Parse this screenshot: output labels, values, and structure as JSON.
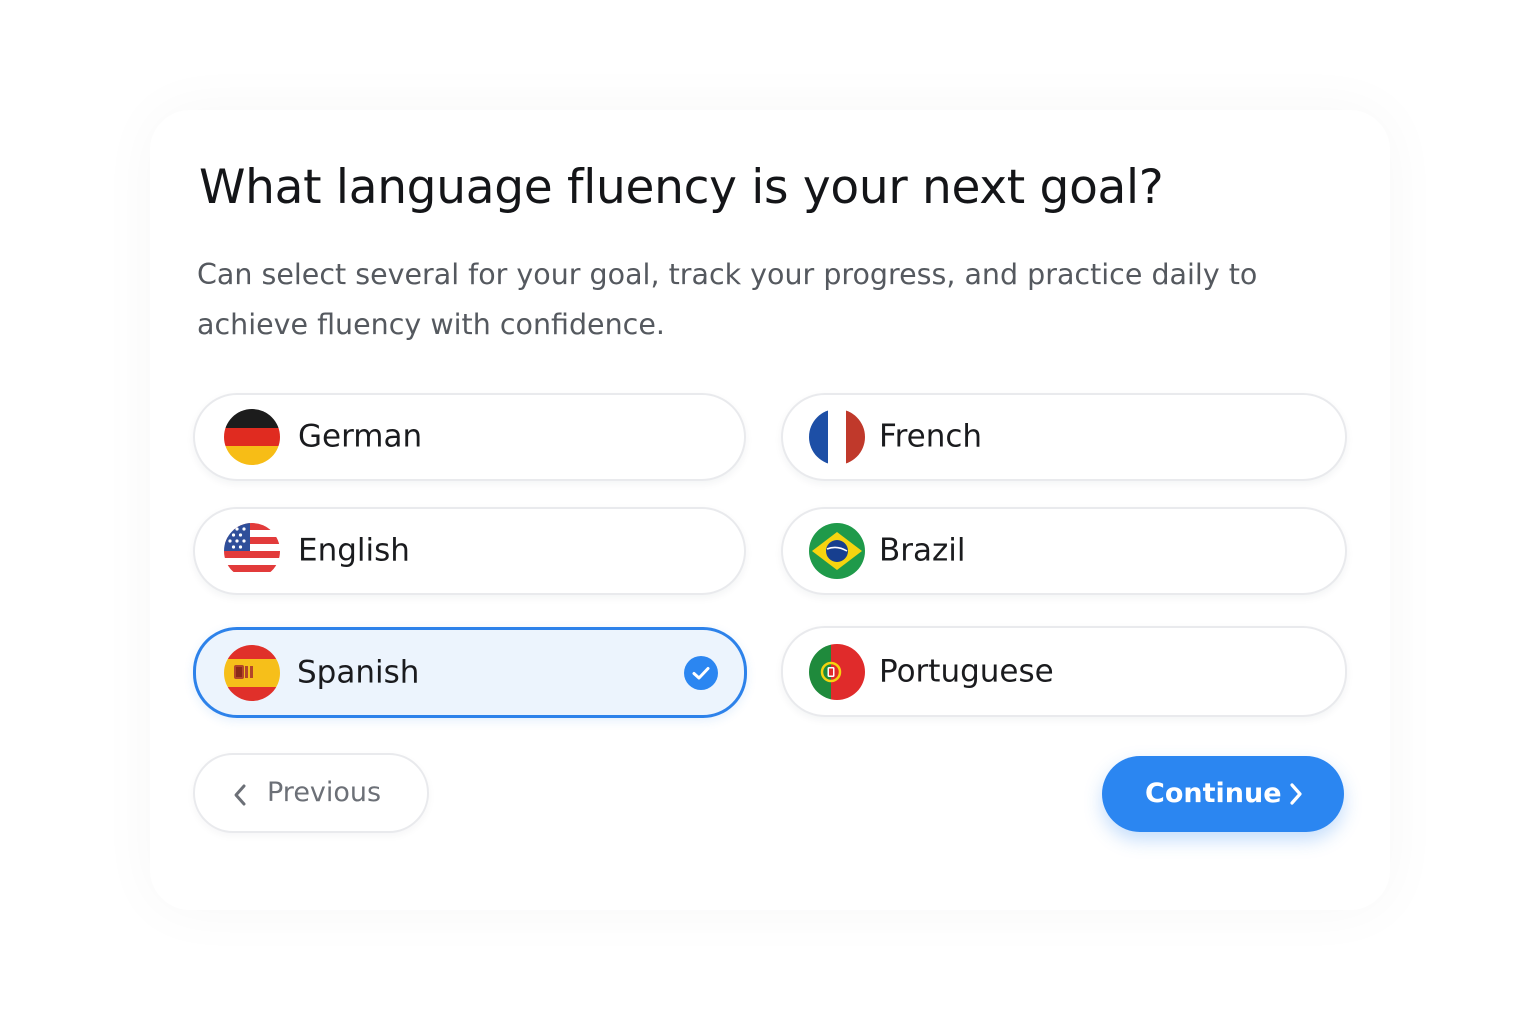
{
  "header": {
    "title": "What language fluency is your next goal?",
    "subtitle": "Can select several for your goal, track your progress, and practice daily to achieve fluency with confidence."
  },
  "options": [
    {
      "label": "German",
      "flag": "german-flag-icon",
      "selected": false
    },
    {
      "label": "French",
      "flag": "french-flag-icon",
      "selected": false
    },
    {
      "label": "English",
      "flag": "us-flag-icon",
      "selected": false
    },
    {
      "label": "Brazil",
      "flag": "brazil-flag-icon",
      "selected": false
    },
    {
      "label": "Spanish",
      "flag": "spain-flag-icon",
      "selected": true
    },
    {
      "label": "Portuguese",
      "flag": "portugal-flag-icon",
      "selected": false
    }
  ],
  "footer": {
    "previous_label": "Previous",
    "continue_label": "Continue"
  },
  "colors": {
    "accent": "#2b86f1",
    "selected_bg": "#ecf4fd",
    "selected_border": "#2d82ea"
  }
}
